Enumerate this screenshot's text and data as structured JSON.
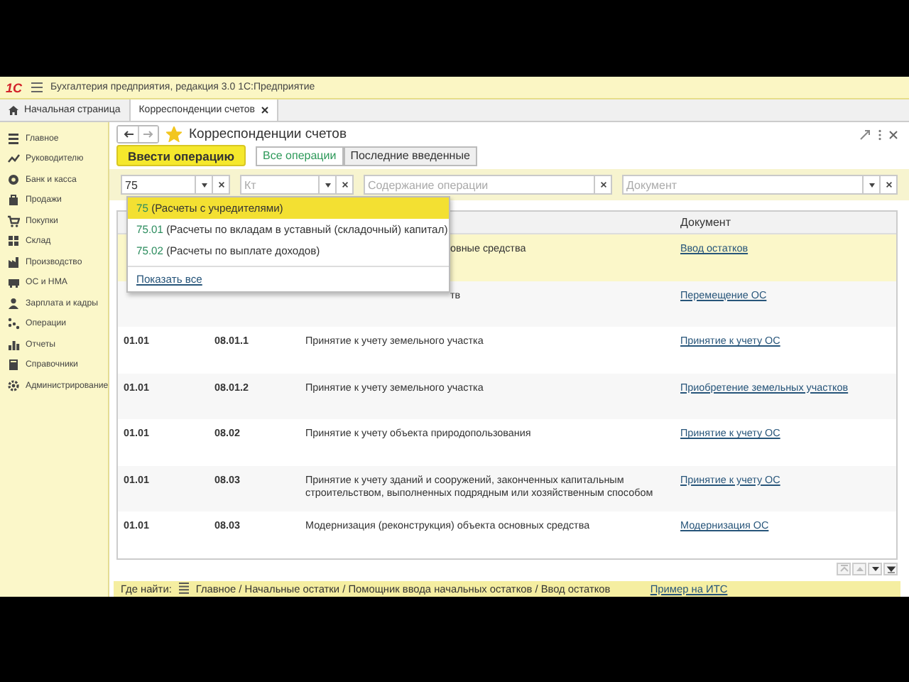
{
  "window": {
    "title": "Бухгалтерия предприятия, редакция 3.0 1С:Предприятие",
    "logo": "1С"
  },
  "tabs": [
    {
      "label": "Начальная страница",
      "selected": false,
      "closable": false
    },
    {
      "label": "Корреспонденции счетов",
      "selected": true,
      "closable": true
    }
  ],
  "sidebar": {
    "items": [
      {
        "label": "Главное"
      },
      {
        "label": "Руководителю"
      },
      {
        "label": "Банк и касса"
      },
      {
        "label": "Продажи"
      },
      {
        "label": "Покупки"
      },
      {
        "label": "Склад"
      },
      {
        "label": "Производство"
      },
      {
        "label": "ОС и НМА"
      },
      {
        "label": "Зарплата и кадры"
      },
      {
        "label": "Операции"
      },
      {
        "label": "Отчеты"
      },
      {
        "label": "Справочники"
      },
      {
        "label": "Администрирование"
      }
    ]
  },
  "form": {
    "title": "Корреспонденции счетов",
    "favorite": true,
    "primary_button": "Ввести операцию",
    "view_tabs": [
      {
        "label": "Все операции",
        "selected": true
      },
      {
        "label": "Последние введенные",
        "selected": false
      }
    ],
    "filters": [
      {
        "value": "75",
        "dropdown": true
      },
      {
        "placeholder": "Кт",
        "dropdown": true
      },
      {
        "placeholder": "Содержание операции",
        "dropdown": false
      },
      {
        "placeholder": "Документ",
        "dropdown": true
      }
    ],
    "suggestions": [
      {
        "code": "75",
        "text": "(Расчеты с учредителями)",
        "selected": true
      },
      {
        "code": "75.01",
        "text": "(Расчеты по вкладам в уставный (складочный) капитал)",
        "selected": false
      },
      {
        "code": "75.02",
        "text": "(Расчеты по выплате доходов)",
        "selected": false
      }
    ],
    "show_all": "Показать все",
    "table": {
      "columns": [
        {
          "label": "Документ"
        }
      ],
      "rows": [
        {
          "description": "овные средства",
          "document": "Ввод остатков",
          "selected": true
        },
        {
          "description": "тв",
          "document": "Перемещение ОС",
          "selected": false
        },
        {
          "debit": "01.01",
          "credit": "08.01.1",
          "description": "Принятие к учету земельного участка",
          "document": "Принятие к учету ОС",
          "selected": false
        },
        {
          "debit": "01.01",
          "credit": "08.01.2",
          "description": "Принятие к учету земельного участка",
          "document": "Приобретение земельных участков",
          "selected": false
        },
        {
          "debit": "01.01",
          "credit": "08.02",
          "description": "Принятие к учету объекта природопользования",
          "document": "Принятие к учету ОС",
          "selected": false
        },
        {
          "debit": "01.01",
          "credit": "08.03",
          "description": "Принятие к учету зданий и сооружений, законченных капитальным строительством, выполненных подрядным или хозяйственным способом",
          "document": "Принятие к учету ОС",
          "selected": false
        },
        {
          "debit": "01.01",
          "credit": "08.03",
          "description": "Модернизация (реконструкция) объекта основных средства",
          "document": "Модернизация ОС",
          "selected": false
        }
      ]
    },
    "where_to_find": {
      "label": "Где найти:",
      "path": "Главное / Начальные остатки / Помощник ввода начальных остатков / Ввод остатков",
      "link": "Пример на ИТС"
    }
  }
}
